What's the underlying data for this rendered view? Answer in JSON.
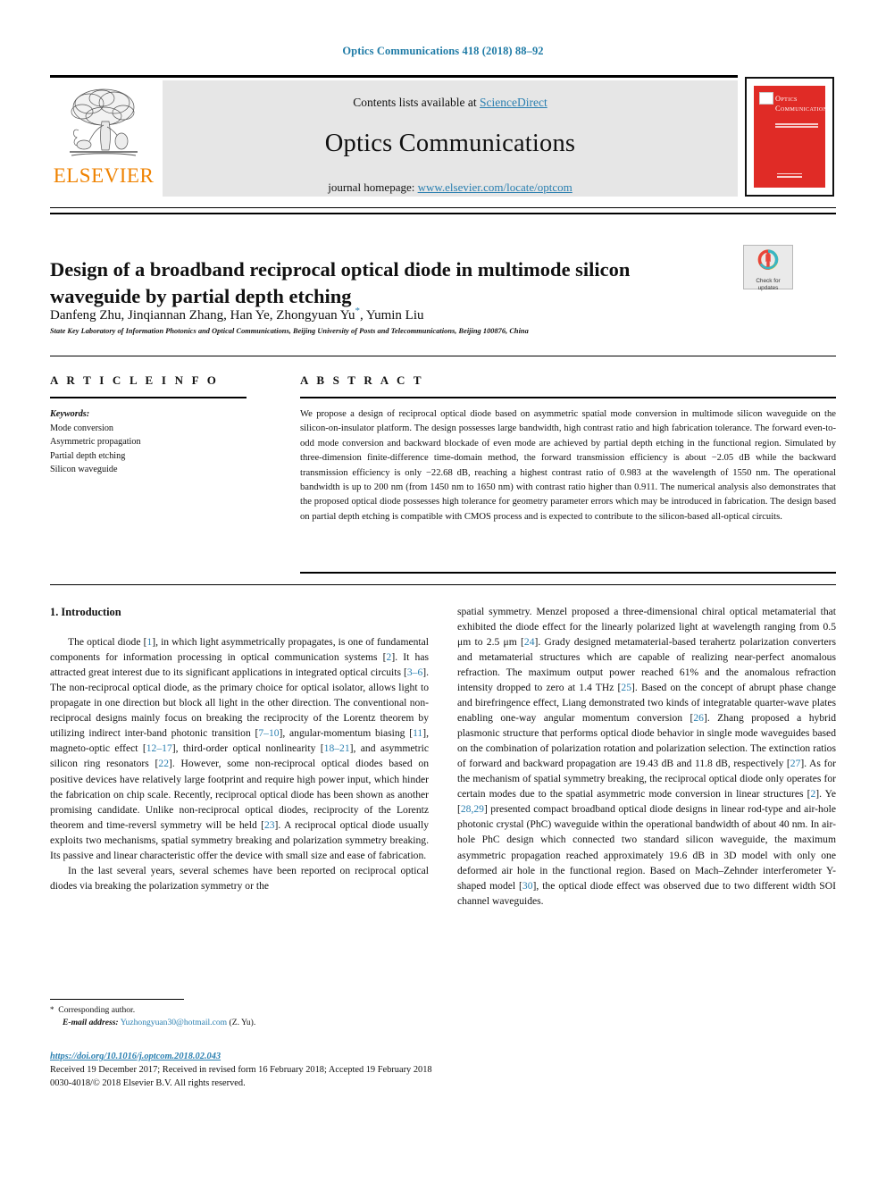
{
  "running_head": "Optics Communications 418 (2018) 88–92",
  "masthead": {
    "contents_prefix": "Contents lists available at ",
    "sciencedirect": "ScienceDirect",
    "journal_name": "Optics Communications",
    "homepage_prefix": "journal homepage: ",
    "homepage_url": "www.elsevier.com/locate/optcom",
    "publisher_wordmark": "ELSEVIER",
    "cover_title": "Optics Communications"
  },
  "crossmark": {
    "line1": "Check for",
    "line2": "updates"
  },
  "title": "Design of a broadband reciprocal optical diode in multimode silicon waveguide by partial depth etching",
  "authors": "Danfeng Zhu, Jinqiannan Zhang, Han Ye, Zhongyuan Yu",
  "authors_tail": ", Yumin Liu",
  "corresponding_marker": "*",
  "affiliation": "State Key Laboratory of Information Photonics and Optical Communications, Beijing University of Posts and Telecommunications, Beijing 100876, China",
  "headings": {
    "article_info": "A R T I C L E   I N F O",
    "abstract": "A B S T R A C T"
  },
  "keywords": {
    "label": "Keywords:",
    "items": [
      "Mode conversion",
      "Asymmetric propagation",
      "Partial depth etching",
      "Silicon waveguide"
    ]
  },
  "abstract_text": "We propose a design of reciprocal optical diode based on asymmetric spatial mode conversion in multimode silicon waveguide on the silicon-on-insulator platform. The design possesses large bandwidth, high contrast ratio and high fabrication tolerance. The forward even-to-odd mode conversion and backward blockade of even mode are achieved by partial depth etching in the functional region. Simulated by three-dimension finite-difference time-domain method, the forward transmission efficiency is about −2.05 dB while the backward transmission efficiency is only −22.68 dB, reaching a highest contrast ratio of 0.983 at the wavelength of 1550 nm. The operational bandwidth is up to 200 nm (from 1450 nm to 1650 nm) with contrast ratio higher than 0.911. The numerical analysis also demonstrates that the proposed optical diode possesses high tolerance for geometry parameter errors which may be introduced in fabrication. The design based on partial depth etching is compatible with CMOS process and is expected to contribute to the silicon-based all-optical circuits.",
  "body": {
    "section_number_title": "1. Introduction",
    "left_paragraph_1": "The optical diode [1], in which light asymmetrically propagates, is one of fundamental components for information processing in optical communication systems [2]. It has attracted great interest due to its significant applications in integrated optical circuits [3–6]. The non-reciprocal optical diode, as the primary choice for optical isolator, allows light to propagate in one direction but block all light in the other direction. The conventional non-reciprocal designs mainly focus on breaking the reciprocity of the Lorentz theorem by utilizing indirect inter-band photonic transition [7–10], angular-momentum biasing [11], magneto-optic effect [12–17], third-order optical nonlinearity [18–21], and asymmetric silicon ring resonators [22]. However, some non-reciprocal optical diodes based on positive devices have relatively large footprint and require high power input, which hinder the fabrication on chip scale. Recently, reciprocal optical diode has been shown as another promising candidate. Unlike non-reciprocal optical diodes, reciprocity of the Lorentz theorem and time-reversl symmetry will be held [23]. A reciprocal optical diode usually exploits two mechanisms, spatial symmetry breaking and polarization symmetry breaking. Its passive and linear characteristic offer the device with small size and ease of fabrication.",
    "left_paragraph_2": "In the last several years, several schemes have been reported on reciprocal optical diodes via breaking the polarization symmetry or the",
    "right_paragraph_1": "spatial symmetry. Menzel proposed a three-dimensional chiral optical metamaterial that exhibited the diode effect for the linearly polarized light at wavelength ranging from 0.5 μm to 2.5 μm [24]. Grady designed metamaterial-based terahertz polarization converters and metamaterial structures which are capable of realizing near-perfect anomalous refraction. The maximum output power reached 61% and the anomalous refraction intensity dropped to zero at 1.4 THz [25]. Based on the concept of abrupt phase change and birefringence effect, Liang demonstrated two kinds of integratable quarter-wave plates enabling one-way angular momentum conversion [26]. Zhang proposed a hybrid plasmonic structure that performs optical diode behavior in single mode waveguides based on the combination of polarization rotation and polarization selection. The extinction ratios of forward and backward propagation are 19.43 dB and 11.8 dB, respectively [27]. As for the mechanism of spatial symmetry breaking, the reciprocal optical diode only operates for certain modes due to the spatial asymmetric mode conversion in linear structures [2]. Ye [28,29] presented compact broadband optical diode designs in linear rod-type and air-hole photonic crystal (PhC) waveguide within the operational bandwidth of about 40 nm. In air-hole PhC design which connected two standard silicon waveguide, the maximum asymmetric propagation reached approximately 19.6 dB in 3D model with only one deformed air hole in the functional region. Based on Mach–Zehnder interferometer Y-shaped model [30], the optical diode effect was observed due to two different width SOI channel waveguides."
  },
  "footnote": {
    "star": "*",
    "corresponding": "Corresponding author.",
    "email_label": "E-mail address:",
    "email": "Yuzhongyuan30@hotmail.com",
    "email_owner": "(Z. Yu)."
  },
  "publication": {
    "doi": "https://doi.org/10.1016/j.optcom.2018.02.043",
    "dates": "Received 19 December 2017; Received in revised form 16 February 2018; Accepted 19 February 2018",
    "copyright": "0030-4018/© 2018 Elsevier B.V. All rights reserved."
  },
  "colors": {
    "link": "#2a7fb0",
    "elsevier_orange": "#ef8200",
    "cover_red": "#e02b26",
    "band_gray": "#e6e6e6"
  }
}
